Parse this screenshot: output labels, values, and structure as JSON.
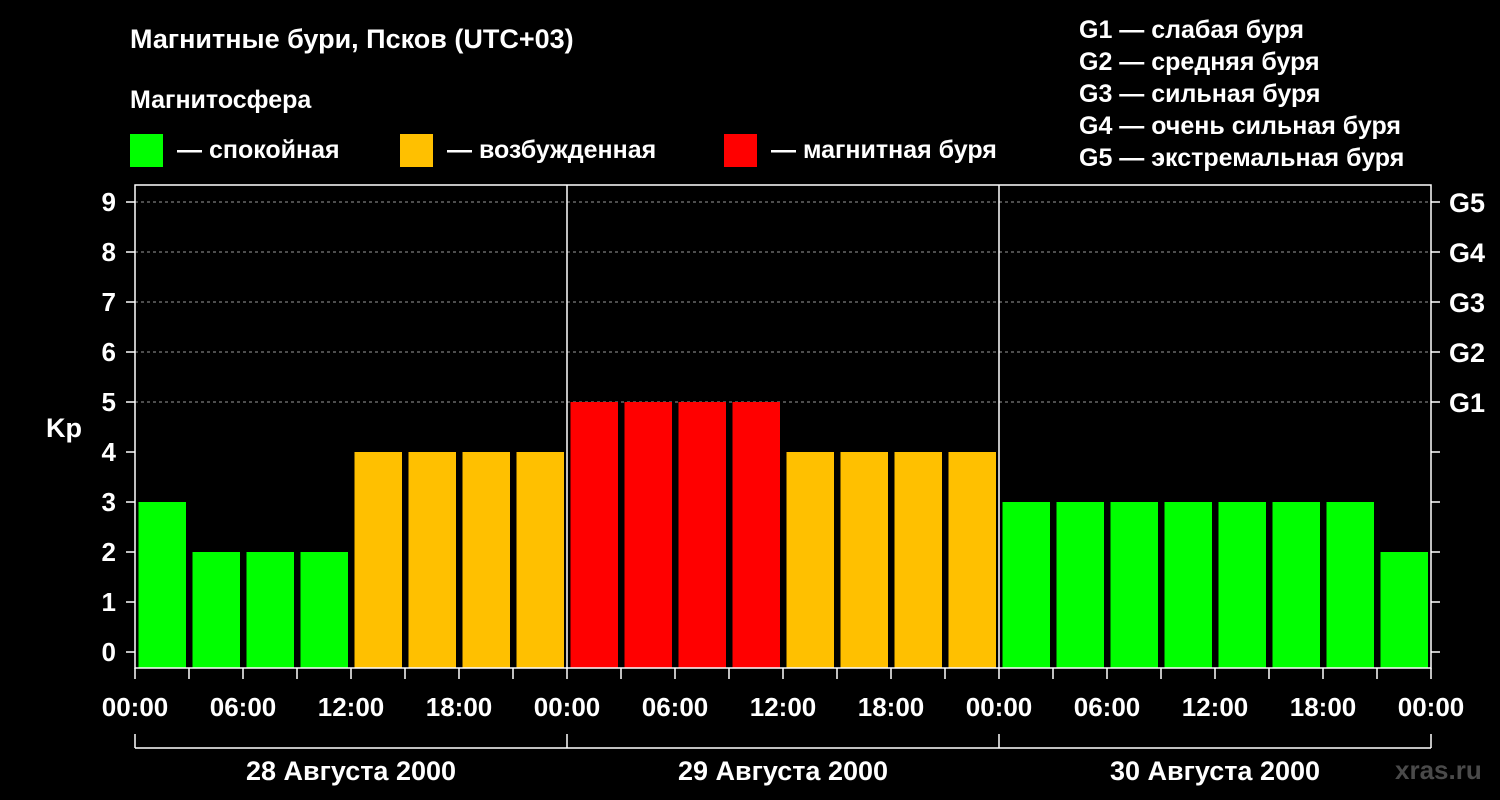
{
  "title": "Магнитные бури, Псков (UTC+03)",
  "subtitle": "Магнитосфера",
  "legend": [
    {
      "label": "— спокойная",
      "color": "#00ff00"
    },
    {
      "label": "— возбужденная",
      "color": "#ffc000"
    },
    {
      "label": "— магнитная буря",
      "color": "#ff0000"
    }
  ],
  "g_levels": [
    "G1 — слабая буря",
    "G2 — средняя буря",
    "G3 — сильная буря",
    "G4 — очень сильная буря",
    "G5 — экстремальная буря"
  ],
  "watermark": "xras.ru",
  "chart_data": {
    "type": "bar",
    "ylabel": "Kp",
    "ylim": [
      0,
      9
    ],
    "yticks": [
      0,
      1,
      2,
      3,
      4,
      5,
      6,
      7,
      8,
      9
    ],
    "right_ticks": [
      {
        "y": 5,
        "label": "G1"
      },
      {
        "y": 6,
        "label": "G2"
      },
      {
        "y": 7,
        "label": "G3"
      },
      {
        "y": 8,
        "label": "G4"
      },
      {
        "y": 9,
        "label": "G5"
      }
    ],
    "xtick_labels": [
      "00:00",
      "06:00",
      "12:00",
      "18:00",
      "00:00",
      "06:00",
      "12:00",
      "18:00",
      "00:00",
      "06:00",
      "12:00",
      "18:00",
      "00:00"
    ],
    "days": [
      "28 Августа 2000",
      "29 Августа 2000",
      "30 Августа 2000"
    ],
    "interval_hours": 3,
    "values": [
      3,
      2,
      2,
      2,
      4,
      4,
      4,
      4,
      5,
      5,
      5,
      5,
      4,
      4,
      4,
      4,
      3,
      3,
      3,
      3,
      3,
      3,
      3,
      2
    ],
    "colors": {
      "quiet": "#00ff00",
      "active": "#ffc000",
      "storm": "#ff0000"
    },
    "grid": true
  }
}
